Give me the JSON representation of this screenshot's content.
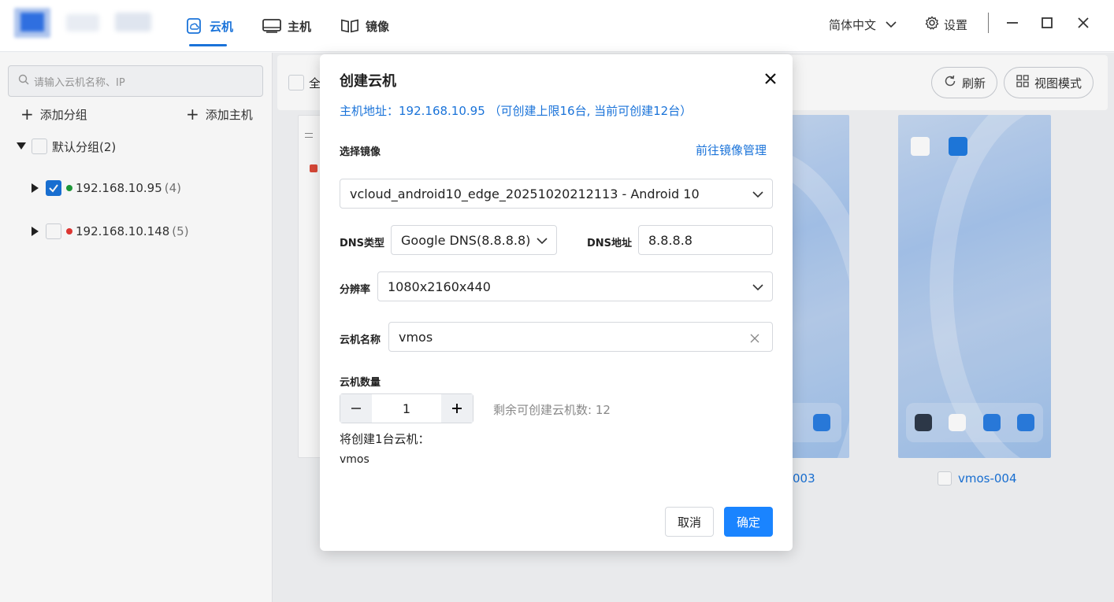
{
  "nav": {
    "tabs": [
      {
        "label": "云机",
        "icon": "cloud-phone-icon",
        "active": true
      },
      {
        "label": "主机",
        "icon": "host-icon",
        "active": false
      },
      {
        "label": "镜像",
        "icon": "image-icon",
        "active": false
      }
    ],
    "language": "简体中文",
    "settings_label": "设置"
  },
  "sidebar": {
    "search_placeholder": "请输入云机名称、IP",
    "add_group_label": "添加分组",
    "add_host_label": "添加主机",
    "group": {
      "label": "默认分组(2)"
    },
    "hosts": [
      {
        "ip": "192.168.10.95",
        "count": "(4)",
        "checked": true,
        "status_color": "#1f9d3a"
      },
      {
        "ip": "192.168.10.148",
        "count": "(5)",
        "checked": false,
        "status_color": "#e53935"
      }
    ]
  },
  "toolbar": {
    "select_all_label": "全",
    "refresh_label": "刷新",
    "view_mode_label": "视图模式"
  },
  "vms": [
    {
      "label": "003"
    },
    {
      "label": "vmos-004"
    }
  ],
  "dialog": {
    "title": "创建云机",
    "host_info": "主机地址：192.168.10.95 （可创建上限16台, 当前可创建12台）",
    "image_label": "选择镜像",
    "image_manage_link": "前往镜像管理",
    "image_value": "vcloud_android10_edge_20251020212113 - Android 10",
    "dns_type_label": "DNS类型",
    "dns_type_value": "Google DNS(8.8.8.8)",
    "dns_addr_label": "DNS地址",
    "dns_addr_value": "8.8.8.8",
    "resolution_label": "分辨率",
    "resolution_value": "1080x2160x440",
    "name_label": "云机名称",
    "name_value": "vmos",
    "quantity_label": "云机数量",
    "quantity_value": "1",
    "remaining_text": "剩余可创建云机数: 12",
    "will_create_text": "将创建1台云机：",
    "name_preview": "vmos",
    "cancel_label": "取消",
    "confirm_label": "确定"
  },
  "colors": {
    "accent": "#1a73d9",
    "primary_button": "#1a84ff",
    "online": "#1f9d3a",
    "offline": "#e53935"
  }
}
